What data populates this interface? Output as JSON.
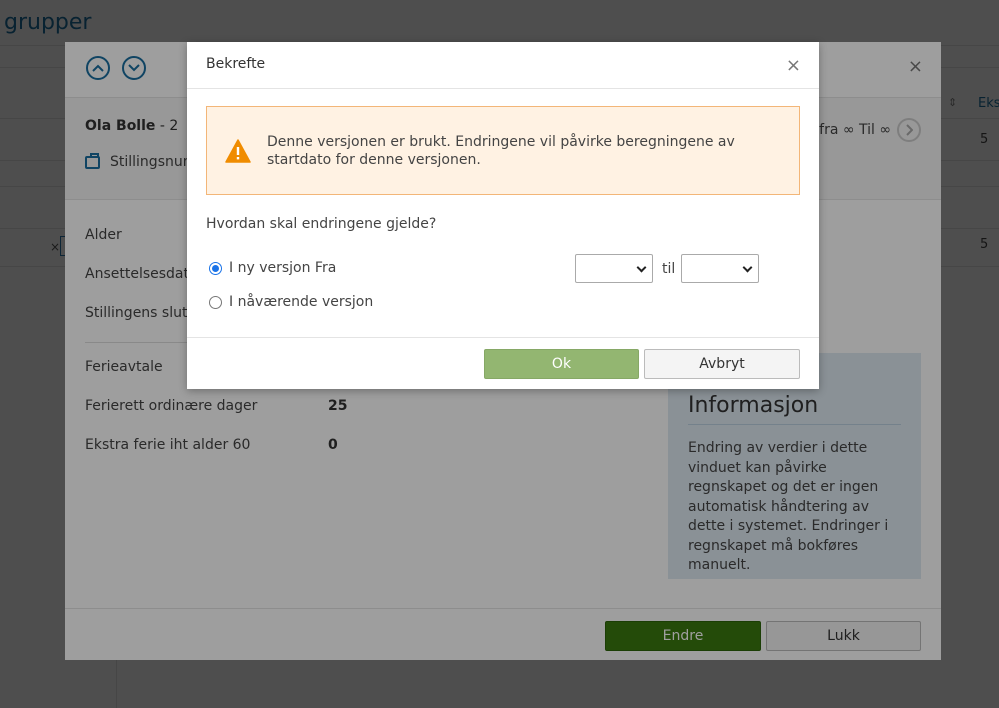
{
  "background": {
    "title": "grupper",
    "column_header": "Eks",
    "rows": [
      {
        "value": "5"
      },
      {
        "value": "5"
      }
    ],
    "clear_glyph": "×"
  },
  "outer_modal": {
    "person_name": "Ola Bolle",
    "person_suffix": " - 2",
    "position_label": "Stillingsnum",
    "validity_text": "fra ∞ Til ∞",
    "close_glyph": "×",
    "fields": [
      {
        "label": "Alder",
        "value": ""
      },
      {
        "label": "Ansettelsesdato",
        "value": ""
      },
      {
        "label": "Stillingens slutto",
        "value": ""
      },
      {
        "label": "Ferieavtale",
        "value": ""
      },
      {
        "label": "Ferierett ordinære dager",
        "value": "25"
      },
      {
        "label": "Ekstra ferie iht alder 60",
        "value": "0"
      }
    ],
    "info_panel": {
      "title": "Informasjon",
      "text": "Endring av verdier i dette vinduet kan påvirke regnskapet og det er ingen automatisk håndtering av dette i systemet. Endringer i regnskapet må bokføres manuelt."
    },
    "buttons": {
      "endre": "Endre",
      "lukk": "Lukk"
    },
    "colors": {
      "primary": "#3a7a0f",
      "link": "#1a6fa0",
      "info_bg": "#dfeaf3"
    }
  },
  "dialog": {
    "title": "Bekrefte",
    "close_glyph": "×",
    "warning_text": "Denne versjonen er brukt. Endringene vil påvirke beregningene av startdato for denne versjonen.",
    "question": "Hvordan skal endringene gjelde?",
    "options": [
      {
        "label": "I ny versjon Fra",
        "checked": true
      },
      {
        "label": "I nåværende versjon",
        "checked": false
      }
    ],
    "from_select_value": "",
    "to_label": "til",
    "to_select_value": "",
    "buttons": {
      "ok": "Ok",
      "cancel": "Avbryt"
    },
    "colors": {
      "warning_bg": "#fff2e3",
      "warning_border": "#f3b678",
      "warning_icon": "#f08c00",
      "ok_bg": "#93b671"
    }
  }
}
